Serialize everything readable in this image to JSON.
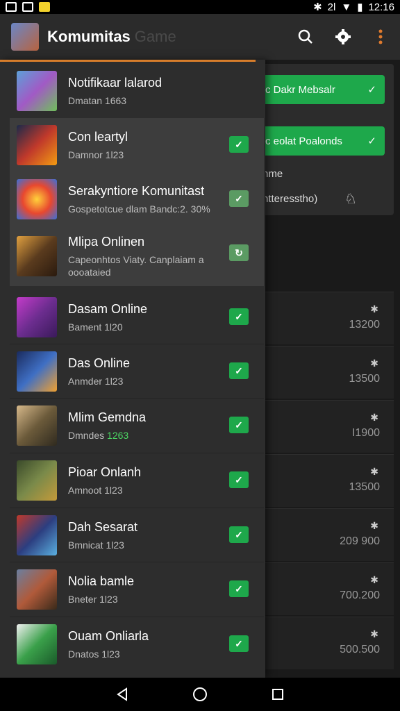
{
  "status_bar": {
    "time": "12:16",
    "signal_text": "2l"
  },
  "appbar": {
    "title": "Komumitas",
    "title_faded": "Game"
  },
  "background": {
    "pill1": "c Dakr Mebsalr",
    "pill2": "c eolat Poalonds",
    "text1": "nme",
    "text2": "ntteresstho)",
    "rows": [
      {
        "value": "13200"
      },
      {
        "value": "13500"
      },
      {
        "value": "I1900"
      },
      {
        "value": "13500"
      },
      {
        "value": "209 900"
      },
      {
        "value": "700.200"
      },
      {
        "value": "500.500"
      }
    ]
  },
  "drawer": {
    "header": {
      "title": "Notifikaar lalarod",
      "subtitle": "Dmatan 1663"
    },
    "items": [
      {
        "title": "Con leartyl",
        "subtitle": "Damnor 1l23"
      },
      {
        "title": "Serakyntiore Komunitast",
        "subtitle": "Gospetotcue dlam Bandc:2. 30%"
      },
      {
        "title": "Mlipa Onlinen",
        "subtitle": "Capeonhtos Viaty. Canplaiam a\noooataied"
      },
      {
        "title": "Dasam Online",
        "subtitle": "Bament 1l20"
      },
      {
        "title": "Das Online",
        "subtitle": "Anmder 1l23"
      },
      {
        "title": "Mlim Gemdna",
        "subtitle": "Dmndes ",
        "subtitle_highlight": "1263"
      },
      {
        "title": "Pioar Onlanh",
        "subtitle": "Amnoot 1l23"
      },
      {
        "title": "Dah Sesarat",
        "subtitle": "Bmnicat 1l23"
      },
      {
        "title": "Nolia bamle",
        "subtitle": "Bneter 1l23"
      },
      {
        "title": "Ouam Onliarla",
        "subtitle": "Dnatos 1l23"
      }
    ]
  },
  "colors": {
    "accent_green": "#1ea84b",
    "accent_orange": "#d77d2b"
  }
}
